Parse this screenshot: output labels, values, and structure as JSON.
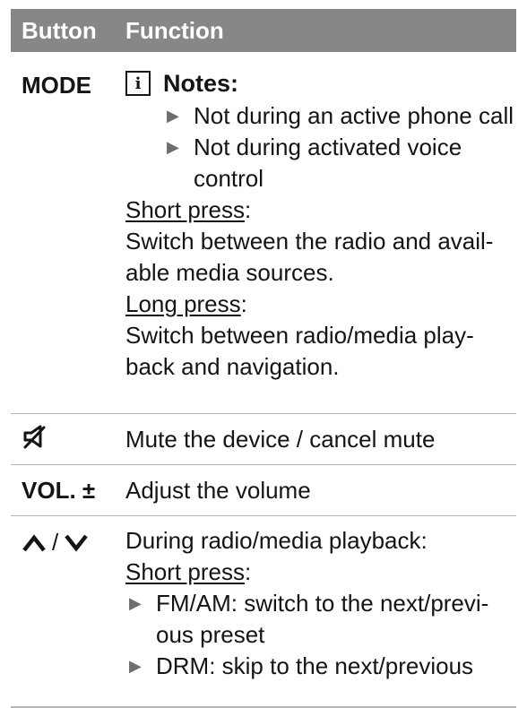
{
  "table": {
    "header": {
      "button": "Button",
      "function": "Function"
    },
    "mode_row": {
      "button": "MODE",
      "notes_icon_letter": "i",
      "notes_title": "Notes:",
      "notes": [
        "Not during an active phone call",
        "Not during activated voice control"
      ],
      "short_press_label": "Short press",
      "short_press_text_line1": "Switch between the radio and avail-",
      "short_press_text_line2": "able media sources.",
      "long_press_label": "Long press",
      "long_press_text_line1": "Switch between radio/media play-",
      "long_press_text_line2": "back and navigation."
    },
    "mute_row": {
      "icon": "mute-speaker-icon",
      "function": "Mute the device / cancel mute"
    },
    "vol_row": {
      "button": "VOL. ±",
      "function": "Adjust the volume"
    },
    "arrows_row": {
      "icon_up": "chevron-up-icon",
      "separator": "/",
      "icon_down": "chevron-down-icon",
      "intro": "During radio/media playback:",
      "short_press_label": "Short press",
      "items": [
        {
          "line1": "FM/AM: switch to the next/previ-",
          "line2": "ous preset"
        },
        {
          "line1": "DRM: skip to the next/previous",
          "line2": ""
        }
      ]
    }
  },
  "colors": {
    "header_bg": "#878787",
    "header_text": "#ffffff",
    "rule": "#b5b5b5",
    "bullet": "#6e6e6e"
  }
}
